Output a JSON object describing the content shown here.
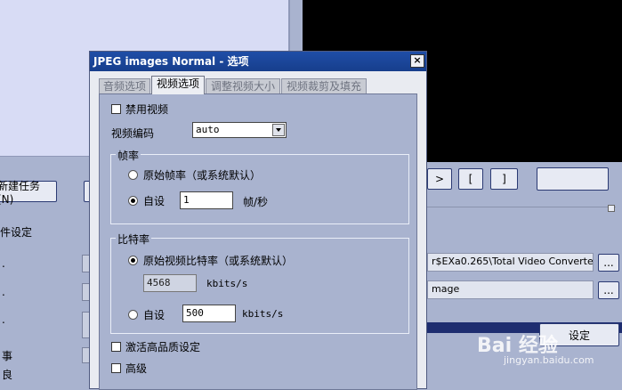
{
  "background": {
    "new_task_label": "新建任务(N)",
    "settings_label": "件设定",
    "nav_buttons": [
      ">",
      "[",
      "]"
    ],
    "path_text": "r$EXa0.265\\Total Video Converter\\Cor",
    "image_text": "mage",
    "browse_label": "...",
    "set_label": "设定",
    "left_fragments": [
      "E",
      ".",
      "..",
      "事",
      "良"
    ]
  },
  "dialog": {
    "title": "JPEG images Normal - 选项",
    "close": "×",
    "tabs": [
      {
        "label": "音频选项",
        "active": false
      },
      {
        "label": "视频选项",
        "active": true
      },
      {
        "label": "调整视频大小",
        "active": false
      },
      {
        "label": "视频裁剪及填充",
        "active": false
      }
    ],
    "disable_video": {
      "label": "禁用视频",
      "checked": false
    },
    "video_codec": {
      "label": "视频编码",
      "value": "auto"
    },
    "frame_rate": {
      "group_label": "帧率",
      "original_option": "原始帧率（或系统默认）",
      "custom_option": "自设",
      "custom_selected": true,
      "custom_value": "1",
      "unit": "帧/秒"
    },
    "bitrate": {
      "group_label": "比特率",
      "original_option": "原始视频比特率（或系统默认）",
      "original_selected": true,
      "original_value": "4568",
      "original_unit": "kbits/s",
      "custom_option": "自设",
      "custom_value": "500",
      "custom_unit": "kbits/s"
    },
    "high_quality": {
      "label": "激活高品质设定",
      "checked": false
    },
    "advanced": {
      "label": "高级",
      "checked": false
    }
  },
  "watermark": {
    "brand": "Bai 经验",
    "url": "jingyan.baidu.com"
  }
}
